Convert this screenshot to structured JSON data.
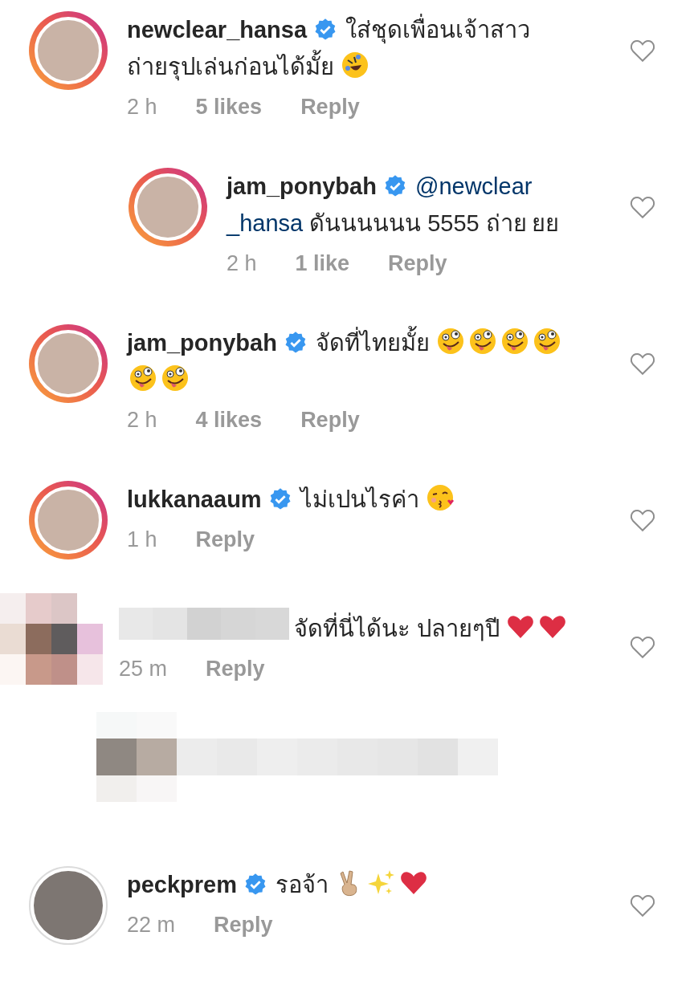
{
  "comments": [
    {
      "kind": "normal",
      "reply": false,
      "ring": true,
      "user": "newclear_hansa",
      "verified": true,
      "body": [
        {
          "kind": "text",
          "text": "ใส่ชุดเพื่อนเจ้าสาว"
        },
        {
          "kind": "text",
          "text": "ถ่ายรุปเล่นก่อนได้มั้ย"
        },
        {
          "kind": "rofl"
        }
      ],
      "time": "2 h",
      "likes": "5 likes",
      "reply_label": "Reply",
      "liked": false
    },
    {
      "kind": "normal",
      "reply": true,
      "ring": true,
      "user": "jam_ponybah",
      "verified": true,
      "body": [
        {
          "kind": "mention",
          "text": "@newclear"
        },
        {
          "kind": "mention",
          "text": "_hansa"
        },
        {
          "kind": "text",
          "text": "ดันนนนนน 5555 ถ่าย"
        },
        {
          "kind": "text",
          "text": "ยย"
        }
      ],
      "time": "2 h",
      "likes": "1 like",
      "reply_label": "Reply",
      "liked": false
    },
    {
      "kind": "normal",
      "reply": false,
      "ring": true,
      "user": "jam_ponybah",
      "verified": true,
      "body": [
        {
          "kind": "text",
          "text": "จัดที่ไทยมั้ย"
        },
        {
          "kind": "zany"
        },
        {
          "kind": "zany"
        },
        {
          "kind": "zany"
        },
        {
          "kind": "zany"
        },
        {
          "kind": "zany"
        },
        {
          "kind": "zany"
        }
      ],
      "time": "2 h",
      "likes": "4 likes",
      "reply_label": "Reply",
      "liked": false
    },
    {
      "kind": "normal",
      "reply": false,
      "ring": true,
      "user": "lukkanaaum",
      "verified": true,
      "body": [
        {
          "kind": "text",
          "text": "ไม่เปนไรค่า"
        },
        {
          "kind": "kiss"
        }
      ],
      "time": "1 h",
      "reply_label": "Reply",
      "liked": false
    },
    {
      "kind": "redacted",
      "reply": false,
      "body": [
        {
          "kind": "text",
          "text": "จัดที่นี่ได้นะ ปลายๆปี"
        },
        {
          "kind": "heart"
        },
        {
          "kind": "heart"
        }
      ],
      "time": "25 m",
      "reply_label": "Reply",
      "liked": false
    },
    {
      "kind": "redacted-line"
    },
    {
      "kind": "normal",
      "reply": false,
      "ring": false,
      "user": "peckprem",
      "verified": true,
      "body": [
        {
          "kind": "text",
          "text": "รอจ้า"
        },
        {
          "kind": "victory"
        },
        {
          "kind": "sparkles"
        },
        {
          "kind": "heart"
        }
      ],
      "time": "22 m",
      "reply_label": "Reply",
      "liked": false
    }
  ]
}
